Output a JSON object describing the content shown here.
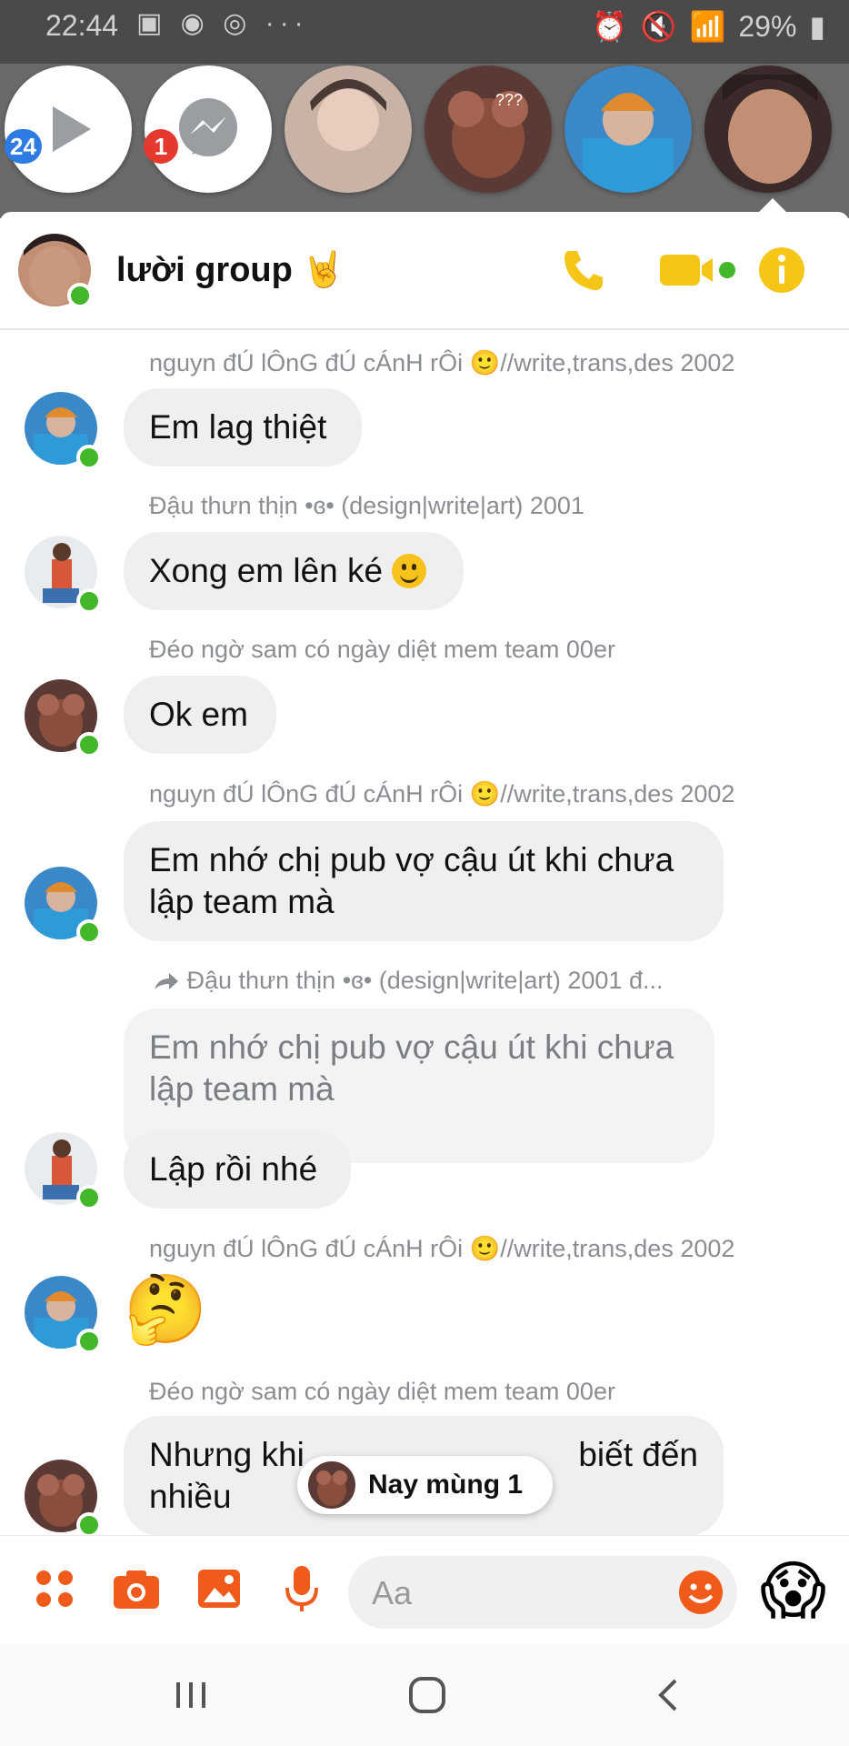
{
  "status_bar": {
    "time": "22:44",
    "left_icons": "▣ ◉ ◎ ···",
    "battery": "29%"
  },
  "chat_heads": {
    "video_badge": "24",
    "messenger_badge": "1"
  },
  "header": {
    "title": "lười group 🤘",
    "accent_color": "#f5c518"
  },
  "messages": [
    {
      "sender": "nguyn đÚ lÔnG đÚ cÁnH rÔi 🙂//write,trans,des 2002",
      "text": "Em lag thiệt"
    },
    {
      "sender": "Đậu thưn thịn •ɞ•  (design|write|art) 2001",
      "text": "Xong em lên ké"
    },
    {
      "sender": "Đéo ngờ sam có ngày diệt mem team 00er",
      "text": "Ok em"
    },
    {
      "sender": "nguyn đÚ lÔnG đÚ cÁnH rÔi 🙂//write,trans,des 2002",
      "line1": "Em nhớ chị pub vợ cậu út khi chưa",
      "line2": "lập team mà"
    },
    {
      "sender": "Đậu thưn thịn •ɞ•  (design|write|art) 2001 đ...",
      "quote_line1": "Em nhớ chị pub vợ cậu út khi chưa",
      "quote_line2": "lập team mà",
      "text": "Lập rồi nhé"
    },
    {
      "sender": "nguyn đÚ lÔnG đÚ cÁnH rÔi 🙂//write,trans,des 2002",
      "emoji": "🤔"
    },
    {
      "sender": "Đéo ngờ sam có ngày diệt mem team 00er",
      "line1_a": "Nhưng khi",
      "line1_b": "biết đến",
      "line2": "nhiều"
    }
  ],
  "date_pill": "Nay mùng 1",
  "composer": {
    "placeholder": "Aa",
    "quick_emoji": "😱",
    "accent_color": "#f05a1a"
  }
}
